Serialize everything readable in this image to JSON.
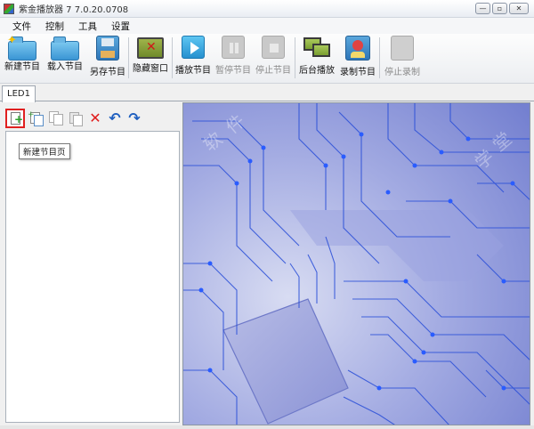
{
  "window": {
    "title": "紫金播放器 7 7.0.20.0708",
    "controls": {
      "minimize": "—",
      "maximize": "▫",
      "close": "✕"
    }
  },
  "menu": [
    "文件",
    "控制",
    "工具",
    "设置"
  ],
  "toolbar": {
    "new_program": "新建节目",
    "load_program": "载入节目",
    "save_as_program": "另存节目",
    "hide_window": "隐藏窗口",
    "play_program": "播放节目",
    "pause_program": "暂停节目",
    "stop_program": "停止节目",
    "background_play": "后台播放",
    "record_program": "录制节目",
    "stop_recording": "停止录制"
  },
  "tabs": {
    "active": "LED1"
  },
  "left_tools": {
    "tooltip": "新建节目页",
    "delete_icon": "✕",
    "undo_icon": "↶",
    "redo_icon": "↷"
  },
  "preview": {
    "background": "circuit-board",
    "accent_colors": [
      "#7f8bd6",
      "#1840d8",
      "#2a5cff"
    ],
    "watermark_chars": [
      "软",
      "件",
      "学",
      "堂"
    ]
  }
}
